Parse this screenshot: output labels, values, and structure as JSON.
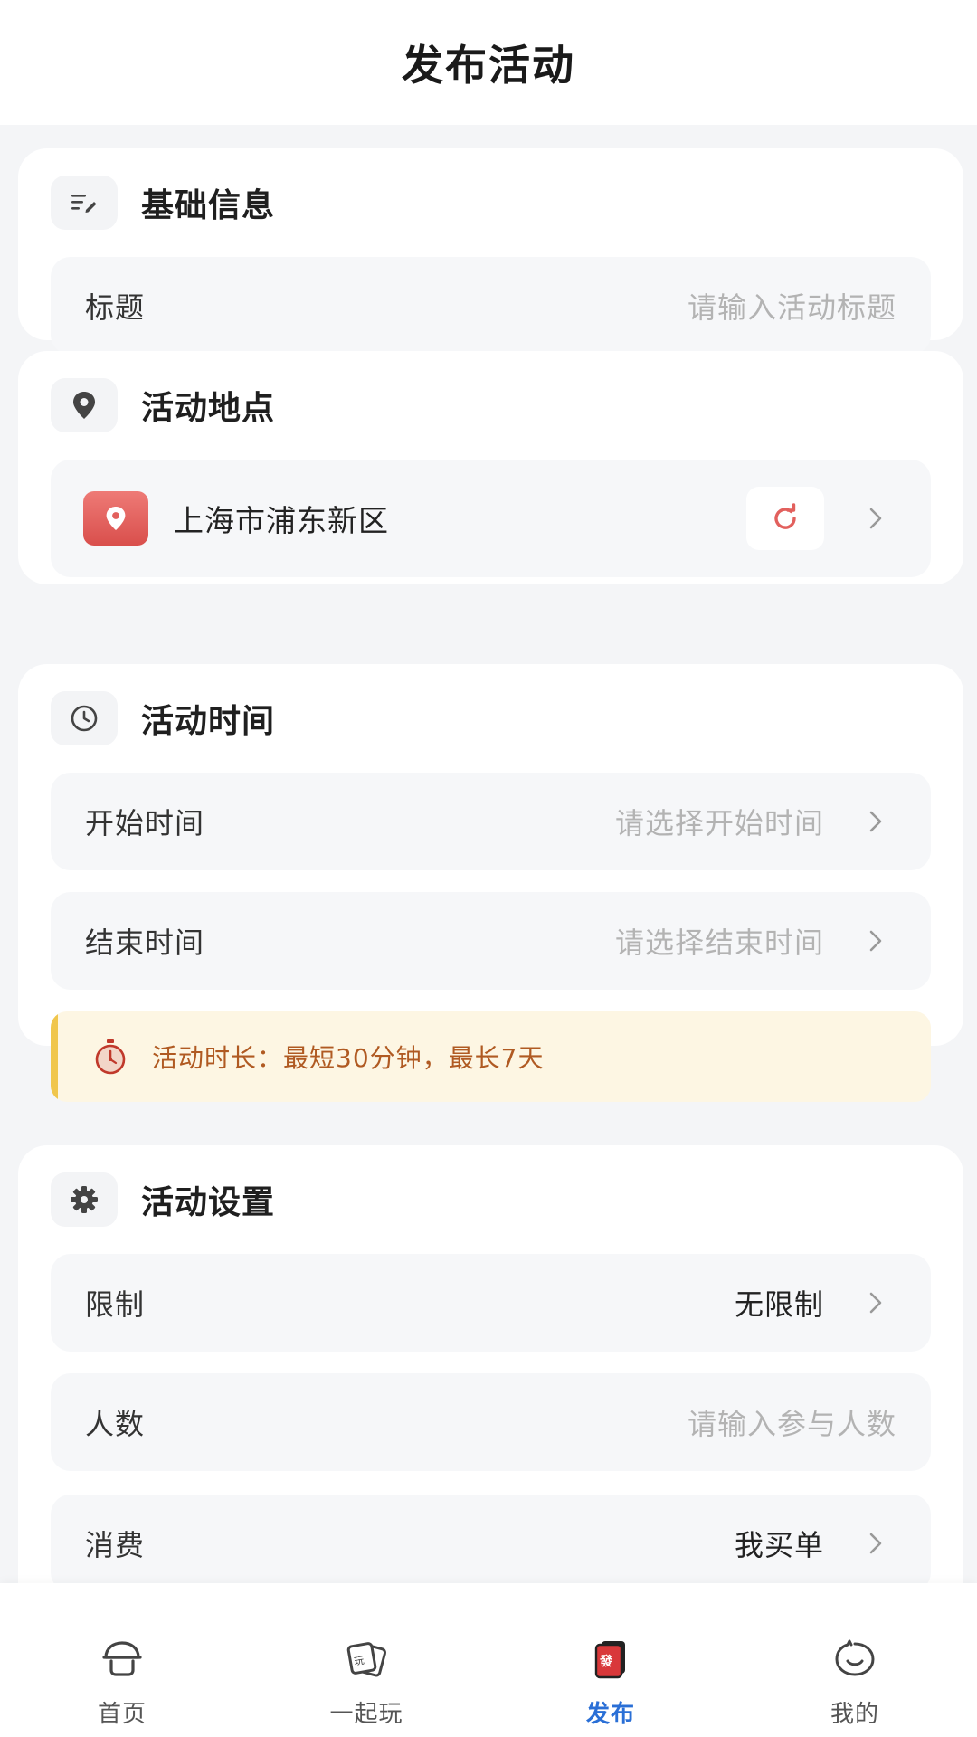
{
  "header": {
    "title": "发布活动"
  },
  "basic_info": {
    "title": "基础信息",
    "icon": "edit-list-icon",
    "title_field": {
      "label": "标题",
      "placeholder": "请输入活动标题"
    }
  },
  "location": {
    "title": "活动地点",
    "icon": "location-pin-icon",
    "address": "上海市浦东新区",
    "accent": "#e2605d"
  },
  "time": {
    "title": "活动时间",
    "icon": "clock-icon",
    "start": {
      "label": "开始时间",
      "placeholder": "请选择开始时间"
    },
    "end": {
      "label": "结束时间",
      "placeholder": "请选择结束时间"
    },
    "notice": "活动时长：最短30分钟，最长7天"
  },
  "settings": {
    "title": "活动设置",
    "icon": "gear-icon",
    "limit": {
      "label": "限制",
      "value": "无限制"
    },
    "people": {
      "label": "人数",
      "placeholder": "请输入参与人数"
    },
    "cost": {
      "label": "消费",
      "value": "我买单"
    }
  },
  "bottom_nav": {
    "items": [
      {
        "label": "首页",
        "icon": "home-icon"
      },
      {
        "label": "一起玩",
        "icon": "play-card-icon"
      },
      {
        "label": "发布",
        "icon": "publish-icon",
        "active": true
      },
      {
        "label": "我的",
        "icon": "profile-icon"
      }
    ],
    "active_color": "#2a6fd6"
  }
}
